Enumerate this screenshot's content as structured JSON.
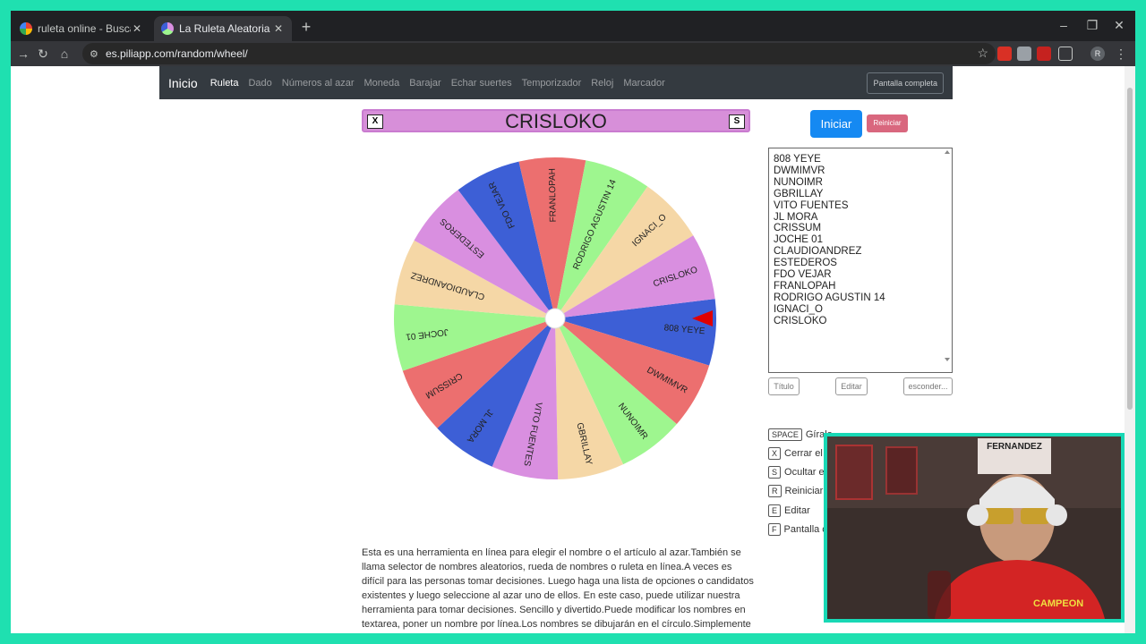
{
  "browser": {
    "tabs": [
      {
        "title": "ruleta online - Buscar con Goog",
        "active": false
      },
      {
        "title": "La Ruleta Aleatoria",
        "active": true
      }
    ],
    "url": "es.piliapp.com/random/wheel/",
    "profile_initial": "R"
  },
  "navbar": {
    "brand": "Inicio",
    "links": [
      "Ruleta",
      "Dado",
      "Números al azar",
      "Moneda",
      "Barajar",
      "Echar suertes",
      "Temporizador",
      "Reloj",
      "Marcador"
    ],
    "fullscreen_label": "Pantalla completa"
  },
  "winner": {
    "close_key": "X",
    "name": "CRISLOKO",
    "hide_key": "S"
  },
  "controls": {
    "start_label": "Iniciar",
    "reset_label": "Reiniciar"
  },
  "names": [
    "808 YEYE",
    "DWMIMVR",
    "NUNOIMR",
    "GBRILLAY",
    "VITO FUENTES",
    "JL MORA",
    "CRISSUM",
    "JOCHE 01",
    "CLAUDIOANDREZ",
    "ESTEDEROS",
    "FDO VEJAR",
    "FRANLOPAH",
    "RODRIGO AGUSTIN 14",
    "IGNACI_O",
    "CRISLOKO"
  ],
  "wheel": {
    "colors": [
      "#3d5fd6",
      "#ec6f6f",
      "#9ef68f",
      "#f5d7a6",
      "#d98fe0"
    ]
  },
  "textarea_buttons": {
    "title": "Título",
    "edit": "Editar",
    "hide": "esconder..."
  },
  "shortcuts": [
    {
      "key": "SPACE",
      "label": "Gíralo"
    },
    {
      "key": "X",
      "label": "Cerrar el b"
    },
    {
      "key": "S",
      "label": "Ocultar el"
    },
    {
      "key": "R",
      "label": "Reiniciar"
    },
    {
      "key": "E",
      "label": "Editar"
    },
    {
      "key": "F",
      "label": "Pantalla c"
    }
  ],
  "description": "Esta es una herramienta en línea para elegir el nombre o el artículo al azar.También se llama selector de nombres aleatorios, rueda de nombres o ruleta en línea.A veces es difícil para las personas tomar decisiones. Luego haga una lista de opciones o candidatos existentes y luego seleccione al azar uno de ellos. En este caso, puede utilizar nuestra herramienta para tomar decisiones. Sencillo y divertido.Puede modificar los nombres en textarea, poner un nombre por línea.Los nombres se dibujarán en el círculo.Simplemente haga clic en la rueda",
  "webcam": {
    "banner_text": "FERNANDEZ",
    "shirt_text": "CAMPEON"
  }
}
